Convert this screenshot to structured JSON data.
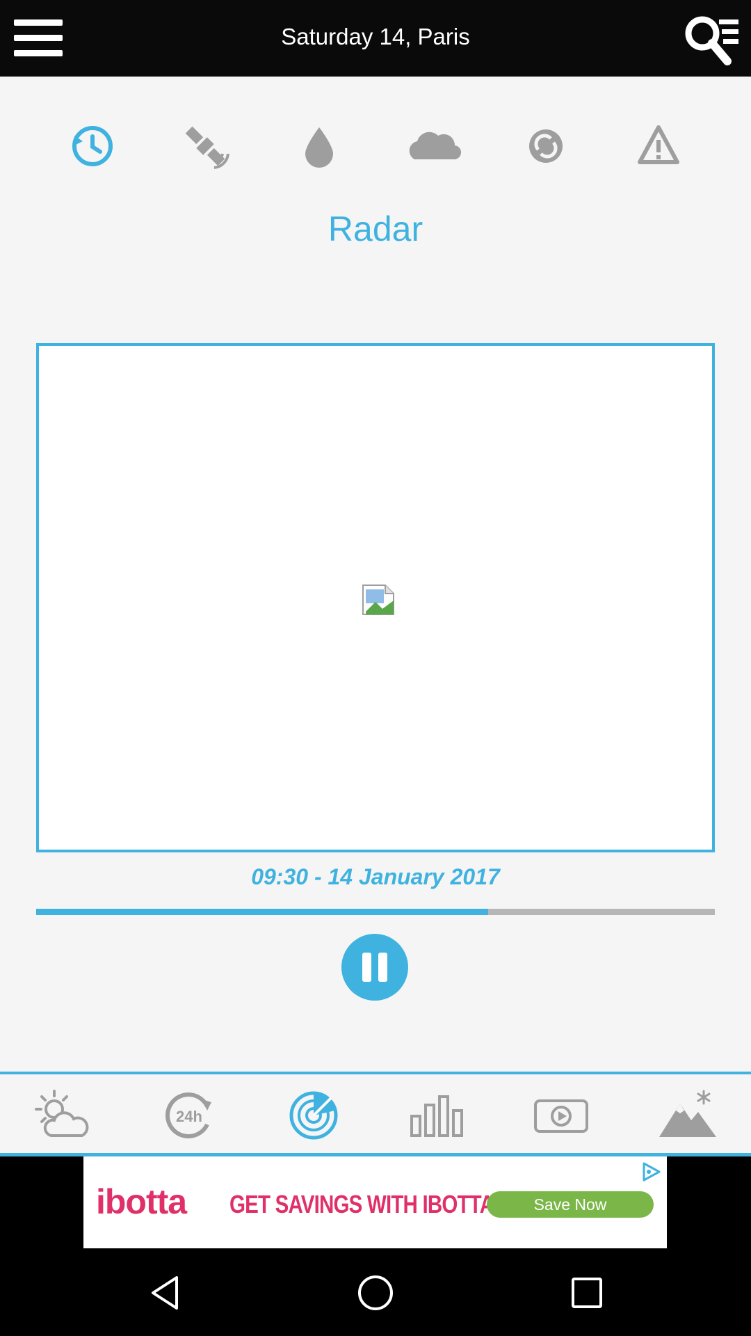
{
  "header": {
    "title": "Saturday 14, Paris",
    "menu_icon": "hamburger-menu-icon",
    "search_icon": "search-list-icon"
  },
  "categories": [
    {
      "name": "history",
      "icon": "history-clock-icon",
      "active": true
    },
    {
      "name": "satellite",
      "icon": "satellite-icon",
      "active": false
    },
    {
      "name": "precipitation",
      "icon": "water-drop-icon",
      "active": false
    },
    {
      "name": "clouds",
      "icon": "cloud-icon",
      "active": false
    },
    {
      "name": "refresh",
      "icon": "refresh-icon",
      "active": false
    },
    {
      "name": "alerts",
      "icon": "warning-icon",
      "active": false
    }
  ],
  "radar": {
    "section_title": "Radar",
    "image_icon": "broken-image-icon",
    "timestamp": "09:30 - 14 January 2017",
    "progress": 0.666,
    "play_state": "playing",
    "pause_icon": "pause-icon"
  },
  "bottom_tabs": [
    {
      "name": "weather",
      "icon": "sun-cloud-icon",
      "active": false
    },
    {
      "name": "24h",
      "icon": "24h-icon",
      "active": false
    },
    {
      "name": "radar",
      "icon": "radar-icon",
      "active": true
    },
    {
      "name": "charts",
      "icon": "bar-chart-icon",
      "active": false
    },
    {
      "name": "video",
      "icon": "video-play-icon",
      "active": false
    },
    {
      "name": "mountain",
      "icon": "mountain-snow-icon",
      "active": false
    }
  ],
  "ad": {
    "brand": "ibotta",
    "text": "GET SAVINGS WITH IBOTTA",
    "cta": "Save Now",
    "choice_icon": "ad-choices-icon"
  },
  "colors": {
    "accent": "#3fb2e0",
    "inactive_icon": "#9e9e9e",
    "brand": "#e0306a",
    "cta": "#7ab648"
  }
}
